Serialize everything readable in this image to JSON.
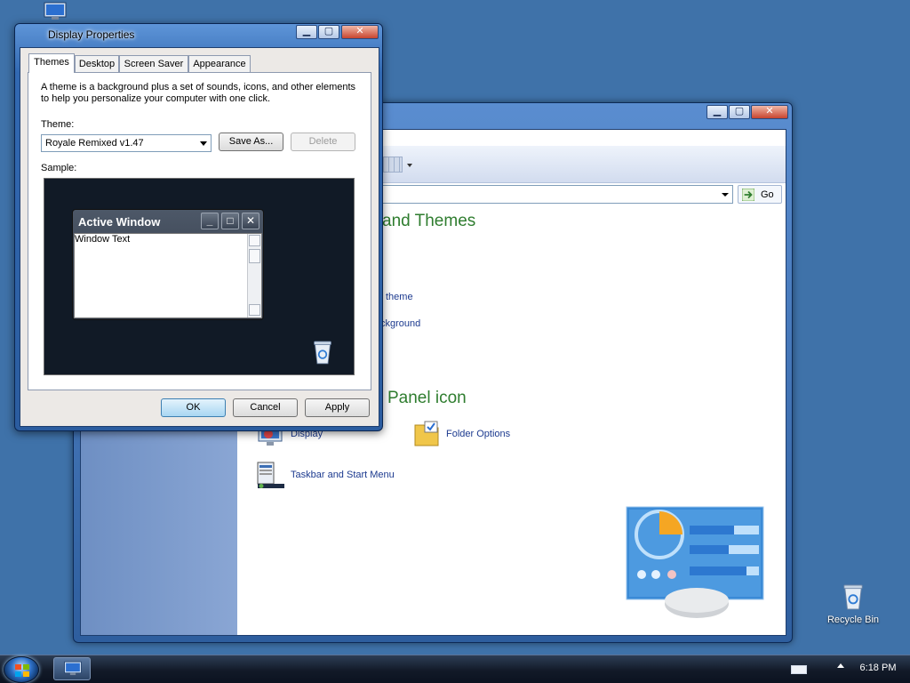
{
  "desktop": {
    "recycle_bin_label": "Recycle Bin"
  },
  "taskbar": {
    "clock": "6:18 PM"
  },
  "control_panel": {
    "go_label": "Go",
    "heading_appearance": "and Themes",
    "link_theme": "theme",
    "link_background": "ckground",
    "heading_pick_icon": "Panel icon",
    "icons": [
      {
        "label": "Display"
      },
      {
        "label": "Folder Options"
      },
      {
        "label": "Taskbar and Start Menu"
      }
    ]
  },
  "display_properties": {
    "title": "Display Properties",
    "tabs": [
      {
        "label": "Themes",
        "active": true
      },
      {
        "label": "Desktop",
        "active": false
      },
      {
        "label": "Screen Saver",
        "active": false
      },
      {
        "label": "Appearance",
        "active": false
      }
    ],
    "description_line1": "A theme is a background plus a set of sounds, icons, and other elements",
    "description_line2": "to help you personalize your computer with one click.",
    "theme_label": "Theme:",
    "theme_value": "Royale Remixed v1.47",
    "save_as_label": "Save As...",
    "delete_label": "Delete",
    "sample_label": "Sample:",
    "sample": {
      "active_window_title": "Active Window",
      "window_text": "Window Text"
    },
    "ok_label": "OK",
    "cancel_label": "Cancel",
    "apply_label": "Apply"
  },
  "colors": {
    "desktop_bg": "#3f72a9",
    "title_bar_blue": "#2b5c9f",
    "sample_bg": "#111a26",
    "heading_green": "#2f7d2f",
    "link_blue": "#1c3a8f"
  }
}
